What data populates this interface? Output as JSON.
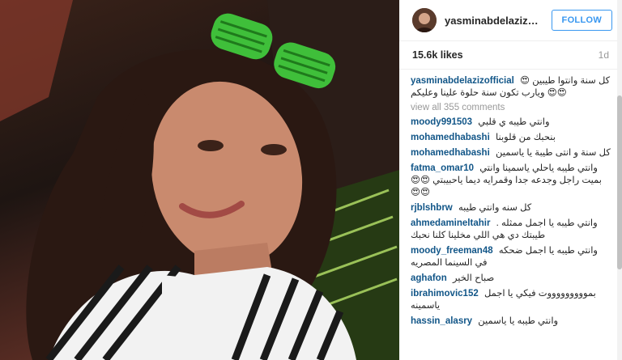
{
  "post": {
    "username": "yasminabdelazizo...",
    "follow_label": "FOLLOW",
    "likes": "15.6k likes",
    "time": "1d",
    "caption_user": "yasminabdelazizofficial",
    "caption_text": "كل سنة وانتوا طيبين 😍😍😍 ويارب تكون سنة حلوة علينا وعليكم",
    "view_all": "view all 355 comments"
  },
  "comments": [
    {
      "user": "moody991503",
      "text": "وانتي طيبه ي قلبي"
    },
    {
      "user": "mohamedhabashi",
      "text": "بنحبك من قلوبنا"
    },
    {
      "user": "mohamedhabashi",
      "text": "كل سنة و انتى طيبة يا ياسمين"
    },
    {
      "user": "fatma_omar10",
      "text": "وانتي طيبه ياحلي ياسمينا وانتي بميت راجل وجدعه جدا وقمرايه ديما ياحبيبتي 😍😍😍😍"
    },
    {
      "user": "rjblshbrw",
      "text": "كل سنه وانتي طيبه"
    },
    {
      "user": "ahmedamineltahir",
      "text": "وانتي طيبه يا اجمل ممثله . طيبتك دي هي اللي مخلينا كلنا نحبك"
    },
    {
      "user": "moody_freeman48",
      "text": "وانتي طيبه يا اجمل ضحكه في السينما المصريه"
    },
    {
      "user": "aghafon",
      "text": "صباح الخير"
    },
    {
      "user": "ibrahimovic152",
      "text": "بموووووووووت فيكي يا اجمل ياسمينه"
    },
    {
      "user": "hassin_alasry",
      "text": "وانتي طيبه يا ياسمين"
    }
  ]
}
